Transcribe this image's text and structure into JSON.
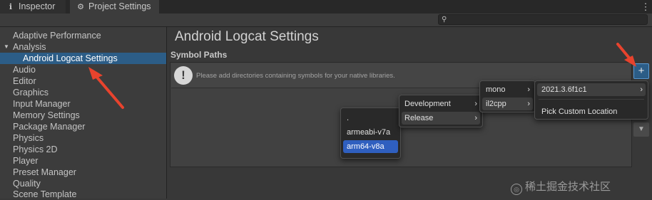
{
  "tabs": {
    "inspector": {
      "label": "Inspector",
      "icon": "info-icon"
    },
    "project_settings": {
      "label": "Project Settings",
      "icon": "gear-icon"
    }
  },
  "search": {
    "value": "",
    "icon": "search-icon"
  },
  "sidebar": {
    "items": [
      {
        "label": "Adaptive Performance"
      },
      {
        "label": "Analysis",
        "expanded": true
      },
      {
        "label": "Android Logcat Settings",
        "selected": true
      },
      {
        "label": "Audio"
      },
      {
        "label": "Editor"
      },
      {
        "label": "Graphics"
      },
      {
        "label": "Input Manager"
      },
      {
        "label": "Memory Settings"
      },
      {
        "label": "Package Manager"
      },
      {
        "label": "Physics"
      },
      {
        "label": "Physics 2D"
      },
      {
        "label": "Player"
      },
      {
        "label": "Preset Manager"
      },
      {
        "label": "Quality"
      },
      {
        "label": "Scene Template"
      }
    ]
  },
  "main": {
    "title": "Android Logcat Settings",
    "section": "Symbol Paths",
    "help_text": "Please add directories containing symbols for your native libraries.",
    "add_button": "+",
    "down_button_icon": "arrow-down-icon"
  },
  "menus": {
    "abi": {
      "items": [
        ".",
        "armeabi-v7a",
        "arm64-v8a"
      ],
      "selected": "arm64-v8a"
    },
    "build": {
      "items": [
        "Development",
        "Release"
      ],
      "highlighted": "Release"
    },
    "backend": {
      "items": [
        "mono",
        "il2cpp"
      ],
      "highlighted": "il2cpp"
    },
    "version": {
      "items": [
        "2021.3.6f1c1",
        "Pick Custom Location"
      ],
      "highlighted": "2021.3.6f1c1"
    }
  },
  "watermark": "稀土掘金技术社区",
  "colors": {
    "selection": "#2c5d87",
    "menu_selected": "#2f5fbf",
    "arrow": "#e8432d"
  }
}
